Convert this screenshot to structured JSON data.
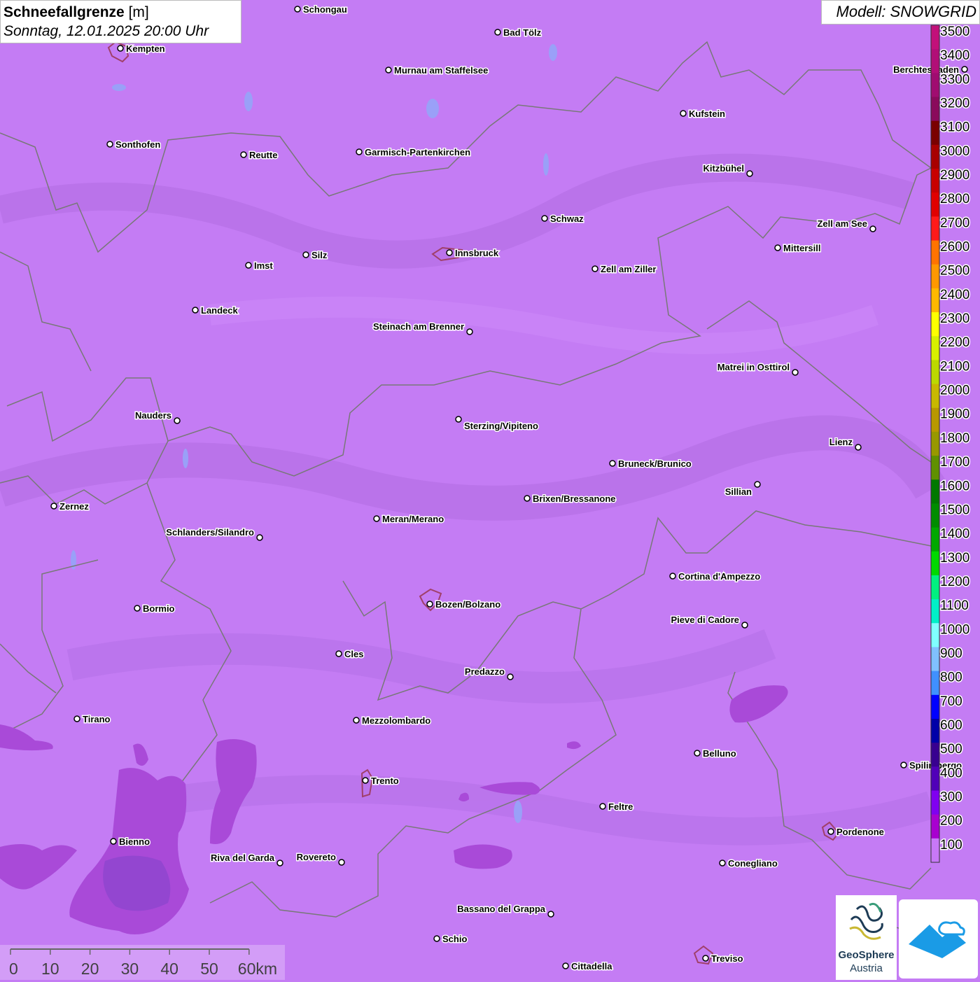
{
  "header": {
    "title": "Schneefallgrenze",
    "unit": "[m]",
    "datetime": "Sonntag, 12.01.2025 20:00 Uhr"
  },
  "model": "Modell: SNOWGRID",
  "legend": {
    "entries": [
      {
        "label": "3500",
        "color": "#c2107a"
      },
      {
        "label": "3400",
        "color": "#b10e77"
      },
      {
        "label": "3300",
        "color": "#a00c70"
      },
      {
        "label": "3200",
        "color": "#8a0a5c"
      },
      {
        "label": "3100",
        "color": "#7a0000"
      },
      {
        "label": "3000",
        "color": "#a80000"
      },
      {
        "label": "2900",
        "color": "#c80000"
      },
      {
        "label": "2800",
        "color": "#e00000"
      },
      {
        "label": "2700",
        "color": "#ff1a1a"
      },
      {
        "label": "2600",
        "color": "#ff7300"
      },
      {
        "label": "2500",
        "color": "#ff9800"
      },
      {
        "label": "2400",
        "color": "#ffb800"
      },
      {
        "label": "2300",
        "color": "#ffff00"
      },
      {
        "label": "2200",
        "color": "#d8f000"
      },
      {
        "label": "2100",
        "color": "#bcd800"
      },
      {
        "label": "2000",
        "color": "#c8b800"
      },
      {
        "label": "1900",
        "color": "#b89800"
      },
      {
        "label": "1800",
        "color": "#989800"
      },
      {
        "label": "1700",
        "color": "#609000"
      },
      {
        "label": "1600",
        "color": "#007800"
      },
      {
        "label": "1500",
        "color": "#008c00"
      },
      {
        "label": "1400",
        "color": "#00a800"
      },
      {
        "label": "1300",
        "color": "#00d800"
      },
      {
        "label": "1200",
        "color": "#00f080"
      },
      {
        "label": "1100",
        "color": "#00f0c8"
      },
      {
        "label": "1000",
        "color": "#80ffff"
      },
      {
        "label": "900",
        "color": "#80c0ff"
      },
      {
        "label": "800",
        "color": "#4090ff"
      },
      {
        "label": "700",
        "color": "#0000ff"
      },
      {
        "label": "600",
        "color": "#0000a8"
      },
      {
        "label": "500",
        "color": "#380090"
      },
      {
        "label": "400",
        "color": "#5000b8"
      },
      {
        "label": "300",
        "color": "#8000f0"
      },
      {
        "label": "200",
        "color": "#a800d0"
      },
      {
        "label": "100",
        "color": "#c878f8"
      }
    ]
  },
  "scale_bar": {
    "labels": [
      "0",
      "10",
      "20",
      "30",
      "40",
      "50",
      "60km"
    ]
  },
  "logos": {
    "geosphere_line1": "GeoSphere",
    "geosphere_line2": "Austria"
  },
  "cities": [
    {
      "name": "Schongau"
    },
    {
      "name": "Bad Tölz"
    },
    {
      "name": "Kempten"
    },
    {
      "name": "Murnau am Staffelsee"
    },
    {
      "name": "Berchtesgaden"
    },
    {
      "name": "Kufstein"
    },
    {
      "name": "Sonthofen"
    },
    {
      "name": "Reutte"
    },
    {
      "name": "Garmisch-Partenkirchen"
    },
    {
      "name": "Kitzbühel"
    },
    {
      "name": "Schwaz"
    },
    {
      "name": "Zell am See"
    },
    {
      "name": "Innsbruck"
    },
    {
      "name": "Mittersill"
    },
    {
      "name": "Imst"
    },
    {
      "name": "Silz"
    },
    {
      "name": "Zell am Ziller"
    },
    {
      "name": "Landeck"
    },
    {
      "name": "Steinach am Brenner"
    },
    {
      "name": "Matrei in Osttirol"
    },
    {
      "name": "Nauders"
    },
    {
      "name": "Sterzing/Vipiteno"
    },
    {
      "name": "Lienz"
    },
    {
      "name": "Bruneck/Brunico"
    },
    {
      "name": "Sillian"
    },
    {
      "name": "Zernez"
    },
    {
      "name": "Brixen/Bressanone"
    },
    {
      "name": "Meran/Merano"
    },
    {
      "name": "Schlanders/Silandro"
    },
    {
      "name": "Cortina d'Ampezzo"
    },
    {
      "name": "Bormio"
    },
    {
      "name": "Bozen/Bolzano"
    },
    {
      "name": "Pieve di Cadore"
    },
    {
      "name": "Cles"
    },
    {
      "name": "Predazzo"
    },
    {
      "name": "Tirano"
    },
    {
      "name": "Mezzolombardo"
    },
    {
      "name": "Belluno"
    },
    {
      "name": "Trento"
    },
    {
      "name": "Feltre"
    },
    {
      "name": "Bienno"
    },
    {
      "name": "Riva del Garda"
    },
    {
      "name": "Rovereto"
    },
    {
      "name": "Pordenone"
    },
    {
      "name": "Conegliano"
    },
    {
      "name": "Bassano del Grappa"
    },
    {
      "name": "Schio"
    },
    {
      "name": "Treviso"
    },
    {
      "name": "Cittadella"
    },
    {
      "name": "Spilimbergo"
    }
  ]
}
